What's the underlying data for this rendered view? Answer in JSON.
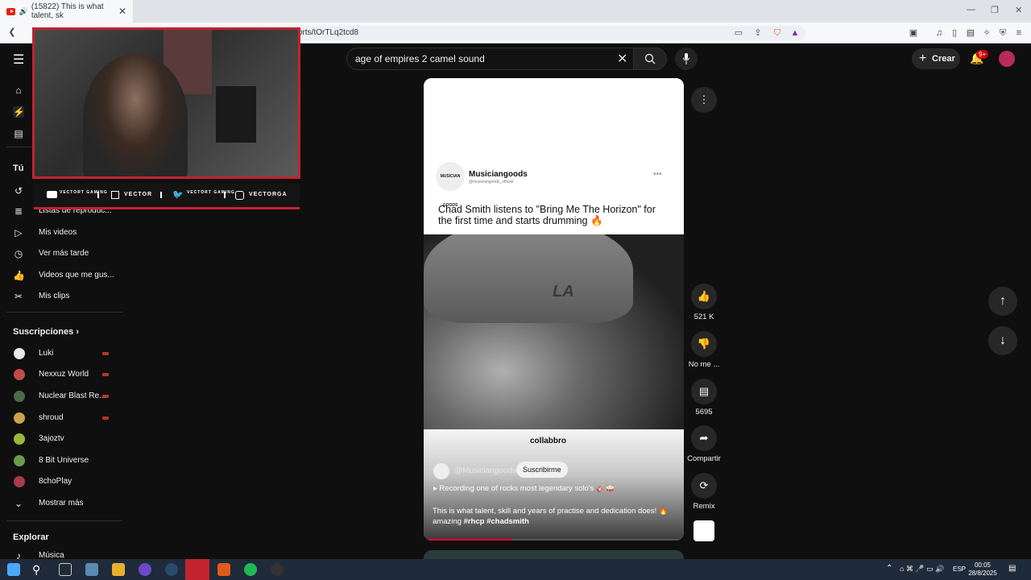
{
  "browser": {
    "tab_title": "(15822) This is what talent, sk",
    "url_fragment": "orts/tOrTLq2tcd8"
  },
  "header": {
    "search_value": "age of empires 2 camel sound",
    "create_label": "Crear",
    "notification_badge": "9+"
  },
  "sidebar": {
    "you_title": "Tú",
    "you_items": [
      {
        "label": "Listas de reproduc...",
        "icon": "playlist-icon"
      },
      {
        "label": "Mis videos",
        "icon": "video-icon"
      },
      {
        "label": "Ver más tarde",
        "icon": "clock-icon"
      },
      {
        "label": "Videos que me gus...",
        "icon": "thumbs-up-icon"
      },
      {
        "label": "Mis clips",
        "icon": "scissors-icon"
      }
    ],
    "subs_title": "Suscripciones",
    "subscriptions": [
      {
        "name": "Luki",
        "color": "#e8e8e8",
        "live": true
      },
      {
        "name": "Nexxuz World",
        "color": "#c44a4a",
        "live": true
      },
      {
        "name": "Nuclear Blast Re...",
        "color": "#4a6a4a",
        "live": true
      },
      {
        "name": "shroud",
        "color": "#c9a24a",
        "live": true
      },
      {
        "name": "3ajoztv",
        "color": "#9ab83a",
        "live": false
      },
      {
        "name": "8 Bit Universe",
        "color": "#6a9a4a",
        "live": false
      },
      {
        "name": "8choPlay",
        "color": "#a83a4a",
        "live": false
      }
    ],
    "show_more": "Mostrar más",
    "explore_title": "Explorar",
    "explore_items": [
      {
        "label": "Música",
        "icon": "music-icon"
      }
    ]
  },
  "overlay": {
    "socials": [
      "VECTOR",
      "VECTORGA"
    ],
    "gaming_labels": [
      "VECTORT GAMING",
      "VECTORT GAMING"
    ]
  },
  "short": {
    "channel_name": "Musiciangoods",
    "channel_handle": "@musiciangoods_official",
    "logo_text": "MUSICIAN GOODS",
    "headline": "Chad Smith listens to \"Bring Me The Horizon\" for the first time and starts drumming 🔥",
    "sponsor": "collabbro",
    "owner": "@Musiciangoods",
    "subscribe_label": "Suscribirme",
    "music_line": "Recording one of rocks most legendary solo's 🎸🥁",
    "description": "This is what talent, skill and years of practise and dedication does! 🔥 amazing",
    "hashtags": "#rhcp #chadsmith",
    "progress_fraction": 0.34
  },
  "actions": [
    {
      "name": "like",
      "icon": "thumbs-up-icon",
      "label": "521 K"
    },
    {
      "name": "dislike",
      "icon": "thumbs-down-icon",
      "label": "No me ..."
    },
    {
      "name": "comments",
      "icon": "comment-icon",
      "label": "5695"
    },
    {
      "name": "share",
      "icon": "share-icon",
      "label": "Compartir"
    },
    {
      "name": "remix",
      "icon": "remix-icon",
      "label": "Remix"
    }
  ],
  "taskbar": {
    "lang": "ESP",
    "time": "00:05",
    "date": "28/8/2025"
  }
}
